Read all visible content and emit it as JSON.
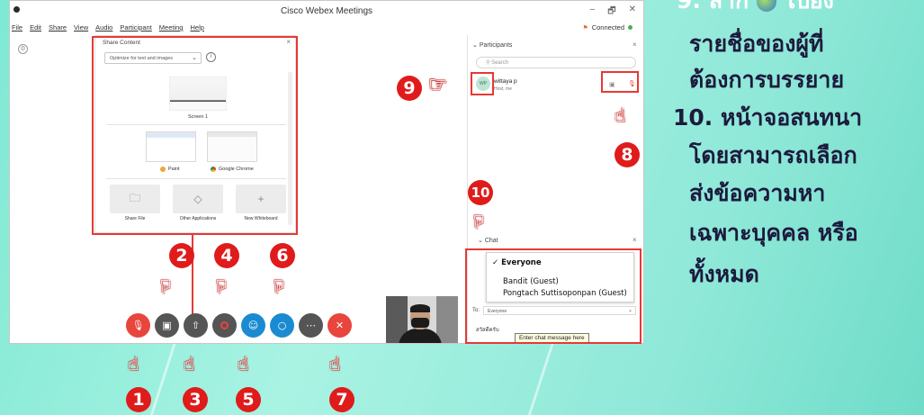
{
  "window": {
    "title": "Cisco Webex Meetings",
    "menus": [
      "File",
      "Edit",
      "Share",
      "View",
      "Audio",
      "Participant",
      "Meeting",
      "Help"
    ],
    "status": "Connected",
    "controls": [
      "–",
      "🗗",
      "✕"
    ]
  },
  "share_panel": {
    "title": "Share Content",
    "option": "Optimize for text and images",
    "screen_label": "Screen 1",
    "apps": [
      "Paint",
      "Google Chrome"
    ],
    "tiles": [
      "Share File",
      "Other Applications",
      "New Whiteboard"
    ]
  },
  "participants": {
    "header": "Participants",
    "search_placeholder": "Search",
    "items": [
      {
        "avatar": "WP",
        "name": "wittaya p",
        "role": "Host, me"
      }
    ]
  },
  "chat": {
    "header": "Chat",
    "options": [
      "Everyone",
      "Bandit (Guest)",
      "Pongtach Suttisoponpan (Guest)"
    ],
    "selected_check": "✓",
    "to_label": "To:",
    "to_value": "Everyone",
    "input_text": "สวัสดีครับ",
    "tooltip": "Enter chat message here"
  },
  "annotations": {
    "numbers": [
      "1",
      "2",
      "3",
      "4",
      "5",
      "6",
      "7",
      "8",
      "9",
      "10"
    ]
  },
  "instructions": {
    "line1": "9. ลาก",
    "line1b": "ไปยัง",
    "line2": "รายชื่อของผู้ที่",
    "line3": "ต้องการบรรยาย",
    "line4": "10. หน้าจอสนทนา",
    "line5": "โดยสามารถเลือก",
    "line6": "ส่งข้อความหา",
    "line7": "เฉพาะบุคคล หรือ",
    "line8": "ทั้งหมด"
  },
  "colors": {
    "annotation_red": "#e01b1b",
    "end_red": "#e8453c",
    "blue": "#1b8bd1",
    "text_dark": "#1c1a3d"
  }
}
